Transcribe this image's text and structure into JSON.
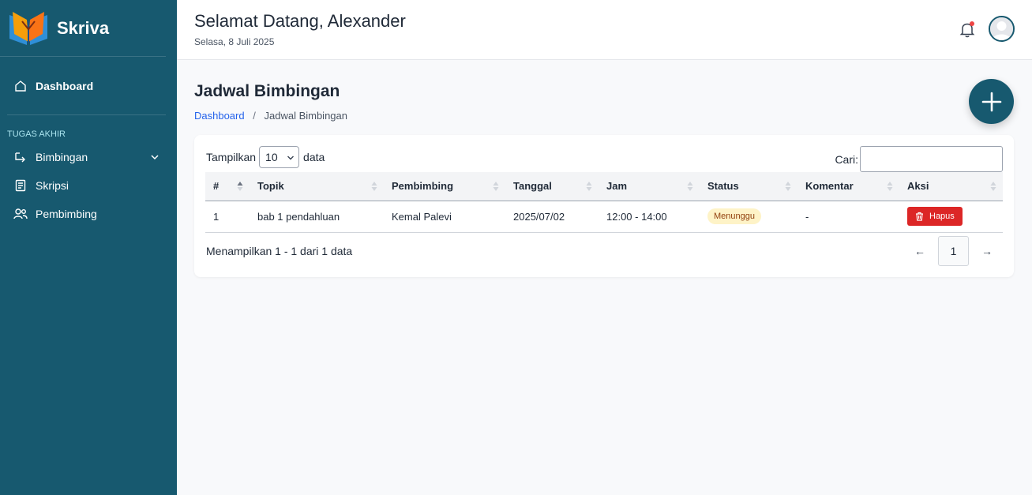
{
  "app": {
    "name": "Skriva"
  },
  "sidebar": {
    "dashboard_label": "Dashboard",
    "section_label": "TUGAS AKHIR",
    "items": [
      {
        "label": "Bimbingan",
        "icon": "message-corner-icon",
        "has_chevron": true
      },
      {
        "label": "Skripsi",
        "icon": "document-icon"
      },
      {
        "label": "Pembimbing",
        "icon": "users-icon"
      }
    ]
  },
  "header": {
    "welcome": "Selamat Datang, Alexander",
    "date": "Selasa, 8 Juli 2025",
    "has_notification": true
  },
  "page": {
    "title": "Jadwal Bimbingan",
    "breadcrumb": {
      "home": "Dashboard",
      "separator": "/",
      "current": "Jadwal Bimbingan"
    }
  },
  "table_controls": {
    "show_prefix": "Tampilkan",
    "page_length": "10",
    "show_suffix": "data",
    "search_label": "Cari:",
    "search_value": ""
  },
  "table": {
    "columns": [
      "#",
      "Topik",
      "Pembimbing",
      "Tanggal",
      "Jam",
      "Status",
      "Komentar",
      "Aksi"
    ],
    "rows": [
      {
        "no": "1",
        "topik": "bab 1 pendahluan",
        "pembimbing": "Kemal Palevi",
        "tanggal": "2025/07/02",
        "jam": "12:00 - 14:00",
        "status": "Menunggu",
        "komentar": "-",
        "aksi": "Hapus"
      }
    ]
  },
  "footer": {
    "info": "Menampilkan 1 - 1 dari 1 data",
    "prev": "←",
    "current_page": "1",
    "next": "→"
  },
  "colors": {
    "sidebar": "#17596f",
    "accent_link": "#2563eb",
    "danger": "#dc2626",
    "badge_warning_bg": "#fef3c7"
  }
}
